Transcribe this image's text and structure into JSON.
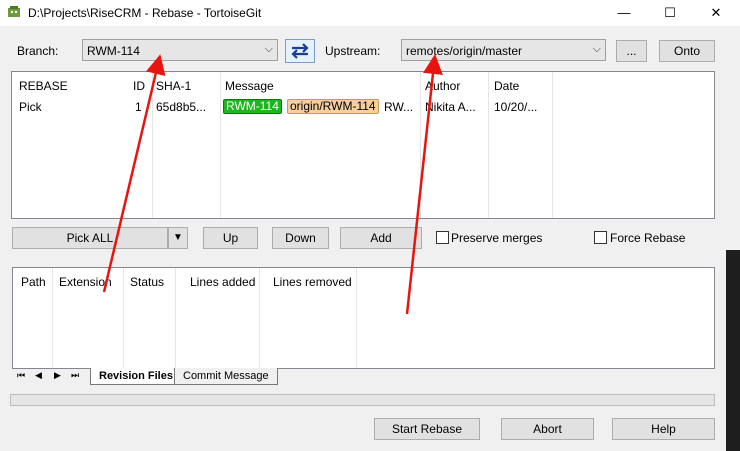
{
  "window": {
    "title": "D:\\Projects\\RiseCRM - Rebase - TortoiseGit",
    "minimize": "—",
    "maximize": "☐",
    "close": "✕"
  },
  "branch": {
    "label": "Branch:",
    "value": "RWM-114"
  },
  "upstream": {
    "label": "Upstream:",
    "value": "remotes/origin/master"
  },
  "buttons": {
    "browse": "...",
    "onto": "Onto",
    "pick_all": "Pick ALL",
    "up": "Up",
    "down": "Down",
    "add": "Add",
    "start_rebase": "Start Rebase",
    "abort": "Abort",
    "help": "Help"
  },
  "options": {
    "preserve_merges": "Preserve merges",
    "force_rebase": "Force Rebase"
  },
  "commits_table": {
    "headers": [
      "REBASE",
      "ID",
      "SHA-1",
      "Message",
      "Author",
      "Date"
    ],
    "rows": [
      {
        "action": "Pick",
        "id": "1",
        "sha": "65d8b5...",
        "tag_local": "RWM-114",
        "tag_remote": "origin/RWM-114",
        "message_rest": "RW...",
        "author": "Nikita A...",
        "date": "10/20/..."
      }
    ]
  },
  "files_table": {
    "headers": [
      "Path",
      "Extension",
      "Status",
      "Lines added",
      "Lines removed"
    ]
  },
  "tabs": [
    "Revision Files",
    "Commit Message"
  ],
  "colors": {
    "tag_local": "#1fb51f",
    "tag_remote": "#f7cf9c",
    "annotation_arrow": "#e8140f"
  }
}
